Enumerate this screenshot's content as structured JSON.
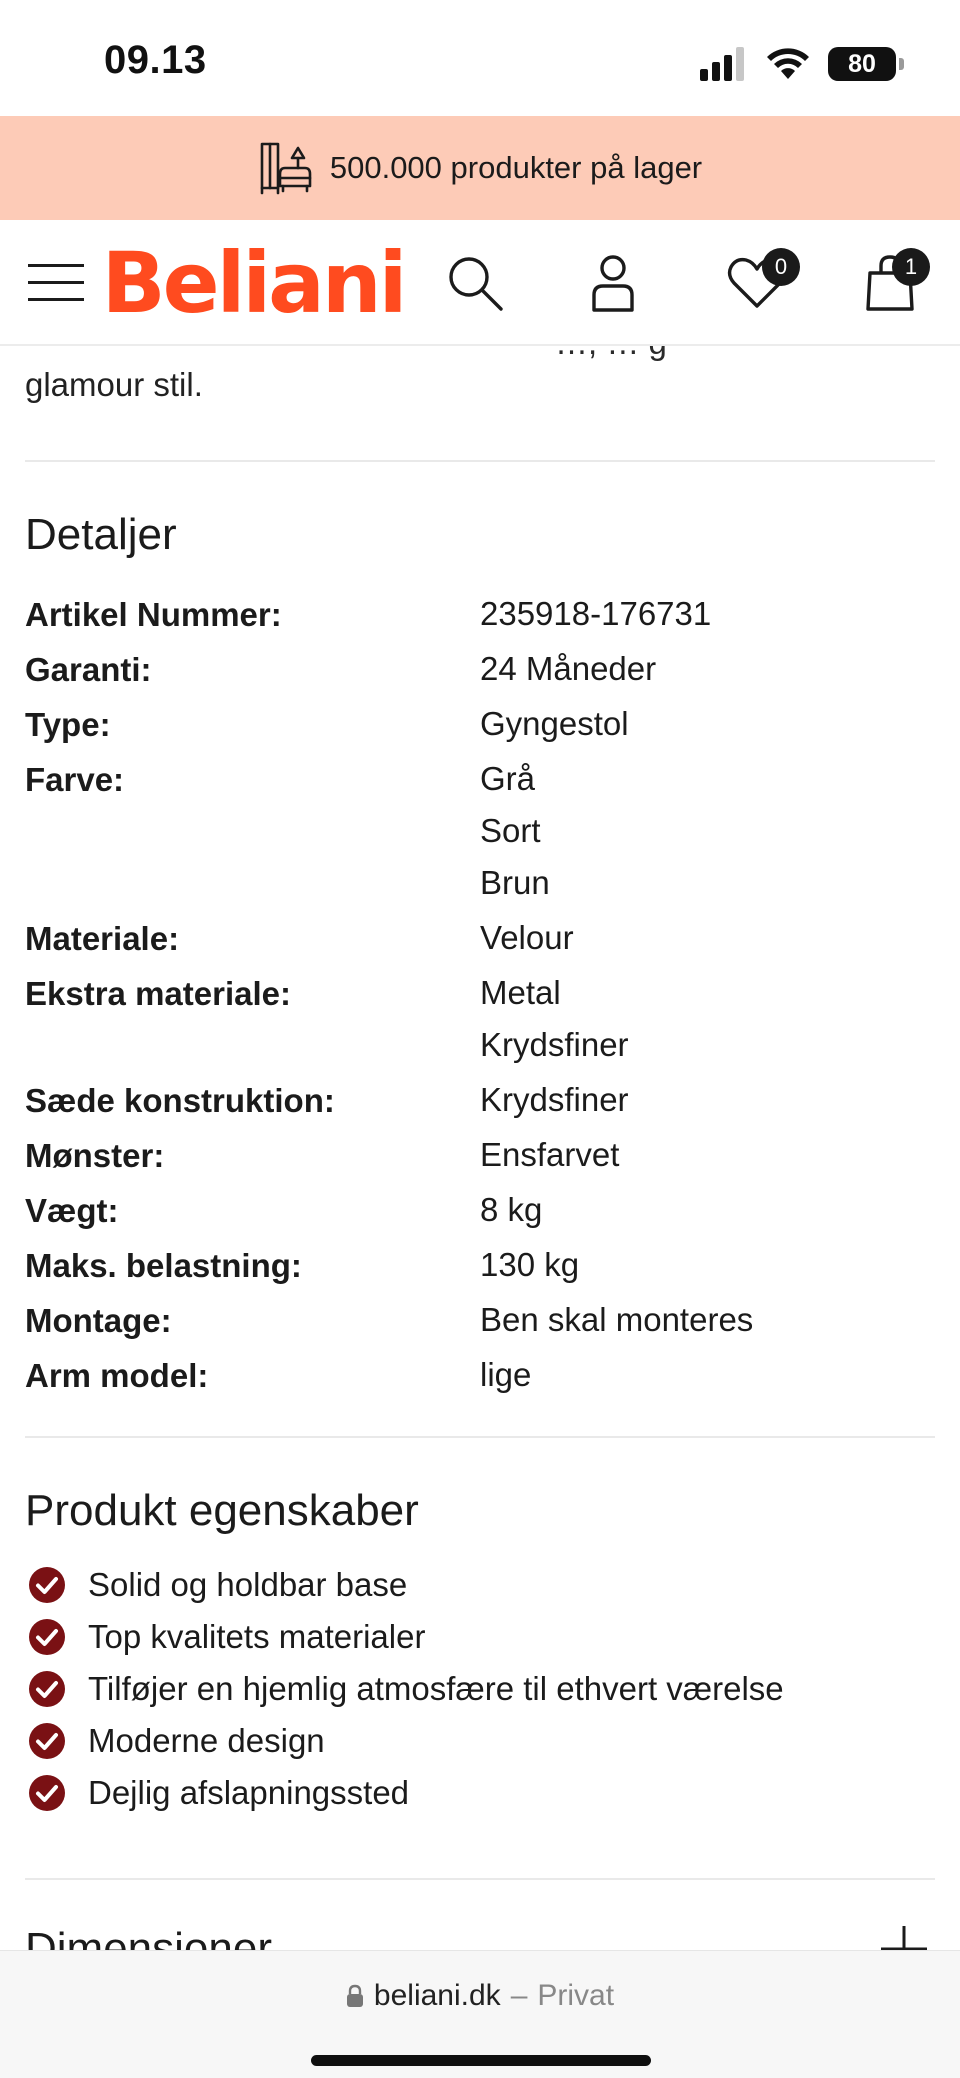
{
  "status_bar": {
    "time": "09.13",
    "battery": "80"
  },
  "promo": {
    "text": "500.000 produkter på lager"
  },
  "header": {
    "logo": "Beliani",
    "wishlist_count": "0",
    "cart_count": "1"
  },
  "intro": {
    "cut_text": "…, … g",
    "tail": "glamour stil."
  },
  "details": {
    "title": "Detaljer",
    "rows": [
      {
        "label": "Artikel Nummer:",
        "values": [
          "235918-176731"
        ]
      },
      {
        "label": "Garanti:",
        "values": [
          "24 Måneder"
        ]
      },
      {
        "label": "Type:",
        "values": [
          "Gyngestol"
        ]
      },
      {
        "label": "Farve:",
        "values": [
          "Grå",
          "Sort",
          "Brun"
        ]
      },
      {
        "label": "Materiale:",
        "values": [
          "Velour"
        ]
      },
      {
        "label": "Ekstra materiale:",
        "values": [
          "Metal",
          "Krydsfiner"
        ]
      },
      {
        "label": "Sæde konstruktion:",
        "values": [
          "Krydsfiner"
        ]
      },
      {
        "label": "Mønster:",
        "values": [
          "Ensfarvet"
        ]
      },
      {
        "label": "Vægt:",
        "values": [
          "8 kg"
        ]
      },
      {
        "label": "Maks. belastning:",
        "values": [
          "130 kg"
        ]
      },
      {
        "label": "Montage:",
        "values": [
          "Ben skal monteres"
        ]
      },
      {
        "label": "Arm model:",
        "values": [
          "lige"
        ]
      }
    ]
  },
  "features": {
    "title": "Produkt egenskaber",
    "items": [
      "Solid og holdbar base",
      "Top kvalitets materialer",
      "Tilføjer en hjemlig atmosfære til ethvert værelse",
      "Moderne design",
      "Dejlig afslapningssted"
    ]
  },
  "dimensions": {
    "title": "Dimensioner"
  },
  "browser": {
    "domain": "beliani.dk",
    "separator": "–",
    "mode": "Privat"
  },
  "colors": {
    "brand": "#ff4b1f",
    "promo_bg": "#fdcbb7",
    "check": "#7a1114"
  }
}
